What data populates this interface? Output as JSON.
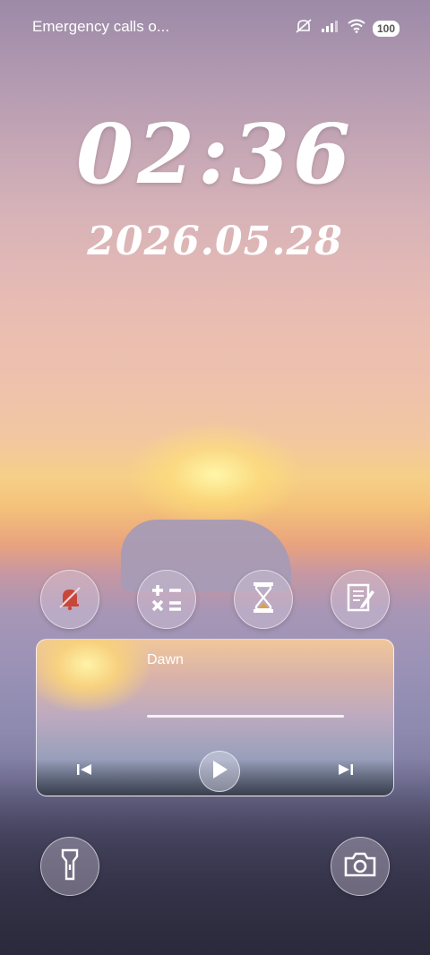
{
  "status_bar": {
    "carrier_text": "Emergency calls o...",
    "battery": "100",
    "icons": [
      "mute-vibrate-icon",
      "signal-icon",
      "wifi-icon",
      "battery-icon"
    ]
  },
  "lockscreen": {
    "time": "02:36",
    "date": "2026.05.28"
  },
  "shortcuts": [
    {
      "name": "silent-mode",
      "icon": "bell-off-icon",
      "color": "#c8473a"
    },
    {
      "name": "calculator",
      "icon": "calculator-icon"
    },
    {
      "name": "timer",
      "icon": "hourglass-icon"
    },
    {
      "name": "notes",
      "icon": "notes-icon"
    }
  ],
  "media": {
    "title": "Dawn",
    "controls": [
      "previous-icon",
      "play-icon",
      "next-icon"
    ]
  },
  "bottom_actions": [
    {
      "name": "flashlight",
      "icon": "flashlight-icon"
    },
    {
      "name": "camera",
      "icon": "camera-icon"
    }
  ]
}
